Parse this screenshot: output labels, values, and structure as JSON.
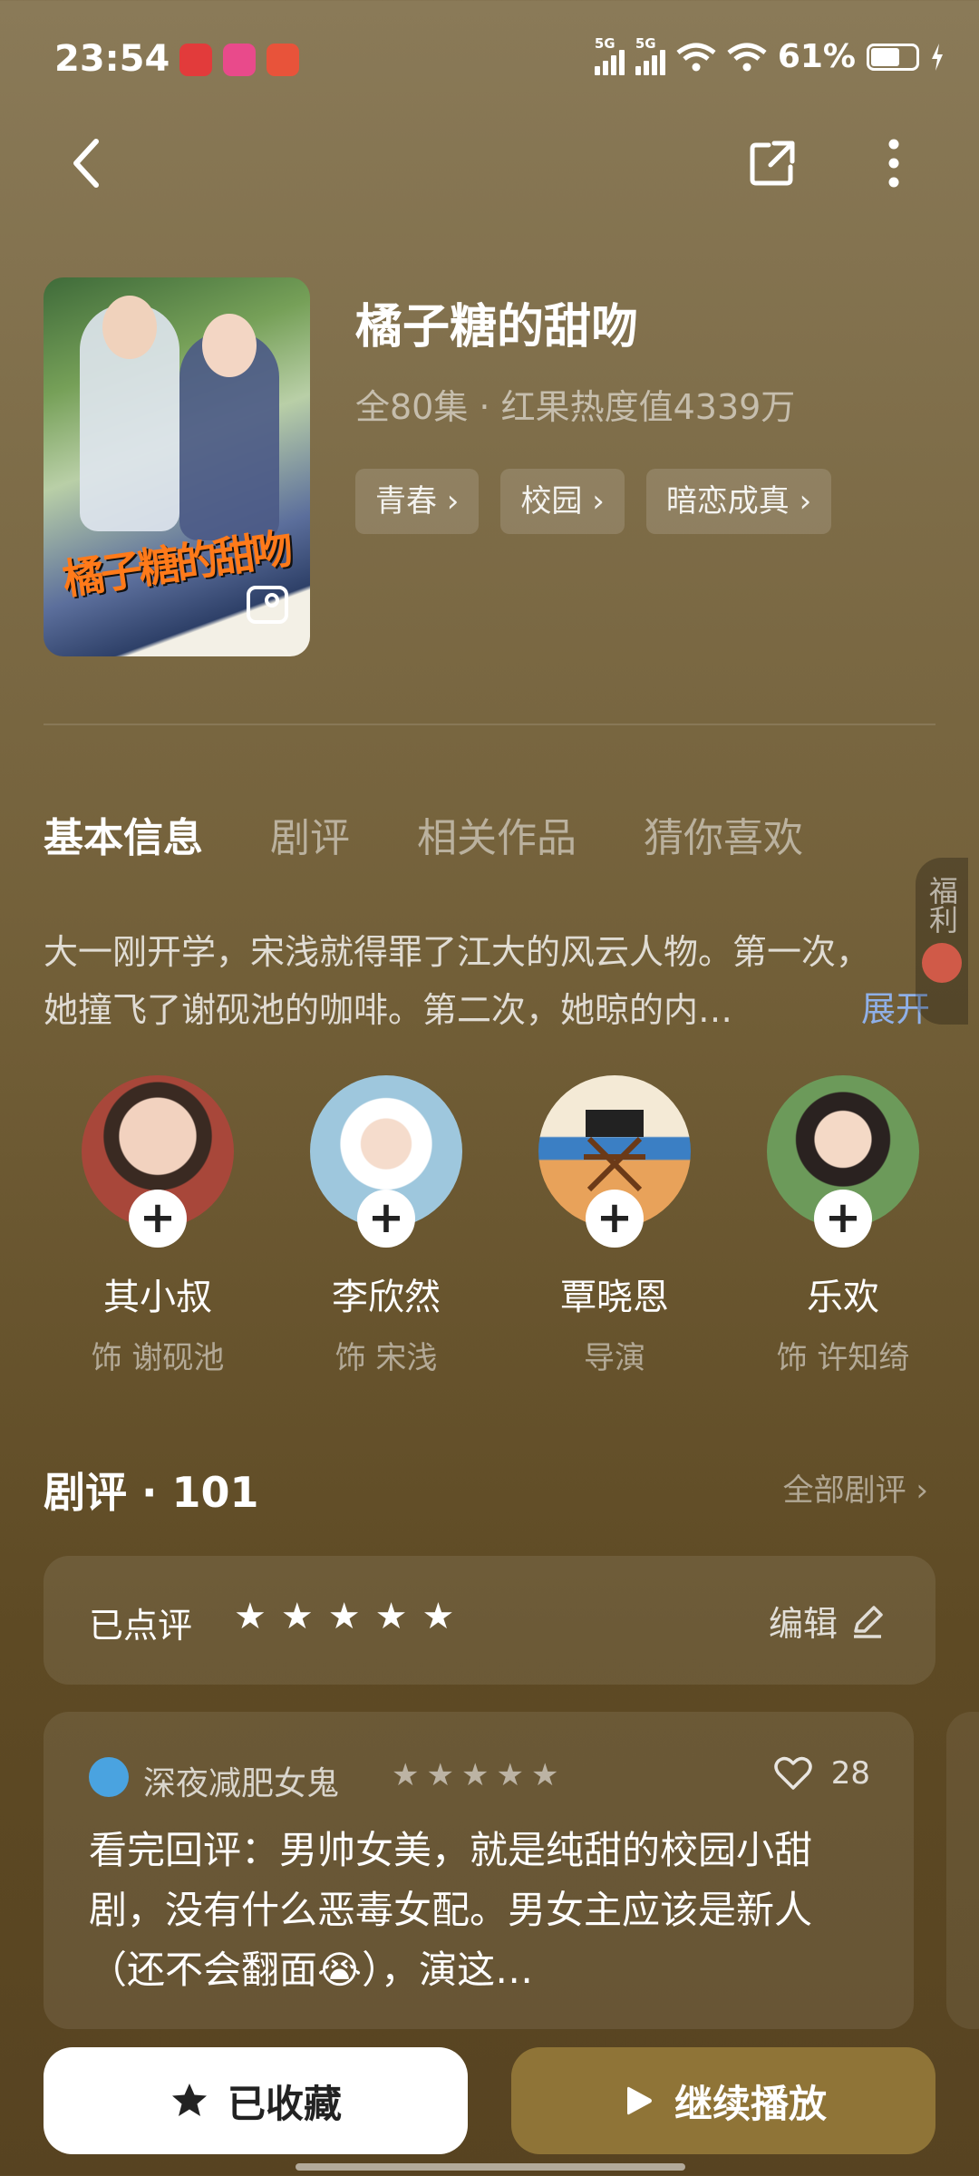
{
  "status_bar": {
    "time": "23:54",
    "battery": "61%",
    "signal1": "5G",
    "signal2": "5G"
  },
  "show": {
    "title": "橘子糖的甜吻",
    "meta": "全80集 · 红果热度值4339万",
    "tags": [
      "青春",
      "校园",
      "暗恋成真"
    ]
  },
  "tabs": [
    "基本信息",
    "剧评",
    "相关作品",
    "猜你喜欢"
  ],
  "description": {
    "line1": "大一刚开学，宋浅就得罪了江大的风云人物。第一次，",
    "line2": "她撞飞了谢砚池的咖啡。第二次，她晾的内…",
    "expand_label": "展开"
  },
  "welfare_label": "福利",
  "cast": [
    {
      "name": "其小叔",
      "role": "饰 谢砚池"
    },
    {
      "name": "李欣然",
      "role": "饰 宋浅"
    },
    {
      "name": "覃晓恩",
      "role": "导演"
    },
    {
      "name": "乐欢",
      "role": "饰 许知绮"
    }
  ],
  "reviews": {
    "heading": "剧评 · 101",
    "all_label": "全部剧评",
    "rated_label": "已点评",
    "edit_label": "编辑",
    "item": {
      "author": "深夜减肥女鬼",
      "likes": "28",
      "text": "看完回评：男帅女美，就是纯甜的校园小甜剧，没有什么恶毒女配。男女主应该是新人（还不会翻面😭），演这…"
    }
  },
  "actions": {
    "favorite_label": "已收藏",
    "play_label": "继续播放"
  }
}
